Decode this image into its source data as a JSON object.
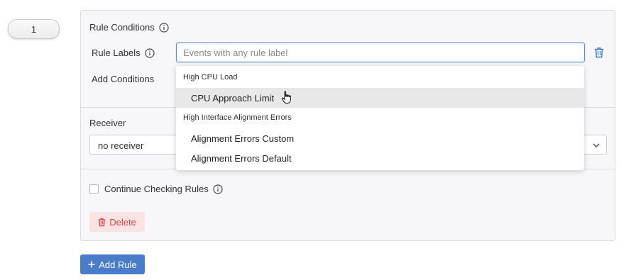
{
  "step": {
    "number": "1"
  },
  "rule_conditions": {
    "title": "Rule Conditions",
    "labels_label": "Rule Labels",
    "labels_placeholder": "Events with any rule label",
    "add_conditions_label": "Add Conditions"
  },
  "receiver": {
    "label": "Receiver",
    "selected": "no receiver"
  },
  "continue_checking": {
    "label": "Continue Checking Rules",
    "checked": false
  },
  "buttons": {
    "delete": "Delete",
    "add_rule": "Add Rule"
  },
  "dropdown": {
    "groups": [
      {
        "header": "High CPU Load",
        "options": [
          "CPU Approach Limit"
        ]
      },
      {
        "header": "High Interface Alignment Errors",
        "options": [
          "Alignment Errors Custom",
          "Alignment Errors Default"
        ]
      }
    ],
    "hovered_option": "CPU Approach Limit"
  },
  "colors": {
    "accent": "#4a7cc9",
    "danger": "#d64545",
    "danger_bg": "#fbe3e3",
    "panel_bg": "#f7f7f9"
  },
  "icons": [
    "info-icon",
    "trash-icon",
    "chevron-down-icon",
    "plus-icon",
    "hand-pointer-icon"
  ]
}
